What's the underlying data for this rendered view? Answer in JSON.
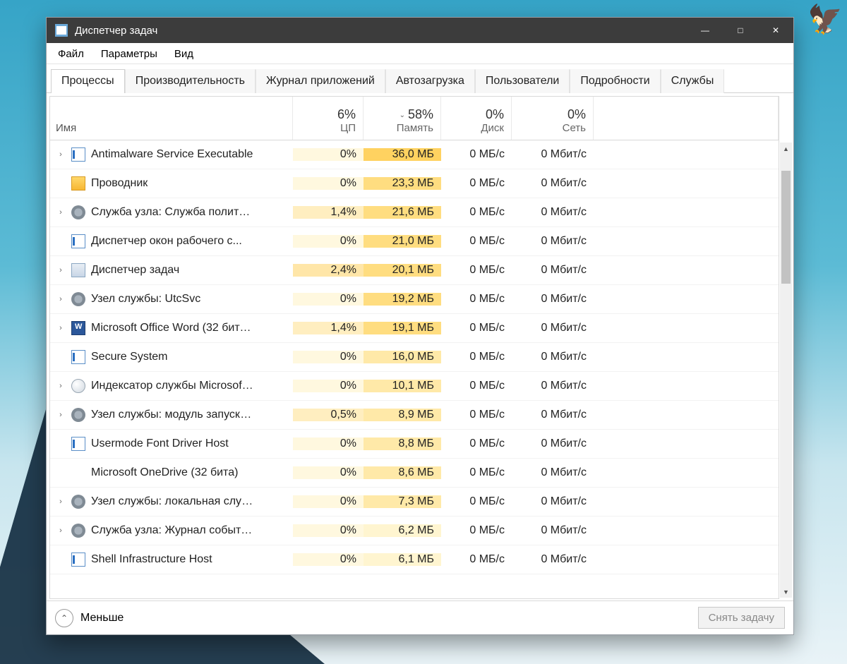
{
  "window": {
    "title": "Диспетчер задач"
  },
  "menu": {
    "file": "Файл",
    "options": "Параметры",
    "view": "Вид"
  },
  "tabs": {
    "processes": "Процессы",
    "performance": "Производительность",
    "apphistory": "Журнал приложений",
    "startup": "Автозагрузка",
    "users": "Пользователи",
    "details": "Подробности",
    "services": "Службы"
  },
  "columns": {
    "name": "Имя",
    "cpu_pct": "6%",
    "cpu_label": "ЦП",
    "mem_pct": "58%",
    "mem_label": "Память",
    "disk_pct": "0%",
    "disk_label": "Диск",
    "net_pct": "0%",
    "net_label": "Сеть"
  },
  "processes": [
    {
      "expand": true,
      "icon": "app",
      "name": "Antimalware Service Executable",
      "cpu": "0%",
      "mem": "36,0 МБ",
      "disk": "0 МБ/с",
      "net": "0 Мбит/с",
      "cpuhl": 0,
      "memhl": 3
    },
    {
      "expand": false,
      "icon": "explorer",
      "name": "Проводник",
      "cpu": "0%",
      "mem": "23,3 МБ",
      "disk": "0 МБ/с",
      "net": "0 Мбит/с",
      "cpuhl": 0,
      "memhl": 2
    },
    {
      "expand": true,
      "icon": "gear",
      "name": "Служба узла: Служба политик...",
      "cpu": "1,4%",
      "mem": "21,6 МБ",
      "disk": "0 МБ/с",
      "net": "0 Мбит/с",
      "cpuhl": 1,
      "memhl": 2
    },
    {
      "expand": false,
      "icon": "app",
      "name": "Диспетчер окон рабочего с...",
      "cpu": "0%",
      "mem": "21,0 МБ",
      "disk": "0 МБ/с",
      "net": "0 Мбит/с",
      "cpuhl": 0,
      "memhl": 2
    },
    {
      "expand": true,
      "icon": "tm",
      "name": "Диспетчер задач",
      "cpu": "2,4%",
      "mem": "20,1 МБ",
      "disk": "0 МБ/с",
      "net": "0 Мбит/с",
      "cpuhl": 2,
      "memhl": 2
    },
    {
      "expand": true,
      "icon": "gear",
      "name": "Узел службы: UtcSvc",
      "cpu": "0%",
      "mem": "19,2 МБ",
      "disk": "0 МБ/с",
      "net": "0 Мбит/с",
      "cpuhl": 0,
      "memhl": 2
    },
    {
      "expand": true,
      "icon": "word",
      "name": "Microsoft Office Word (32 бита...",
      "cpu": "1,4%",
      "mem": "19,1 МБ",
      "disk": "0 МБ/с",
      "net": "0 Мбит/с",
      "cpuhl": 1,
      "memhl": 2
    },
    {
      "expand": false,
      "icon": "app",
      "name": "Secure System",
      "cpu": "0%",
      "mem": "16,0 МБ",
      "disk": "0 МБ/с",
      "net": "0 Мбит/с",
      "cpuhl": 0,
      "memhl": 1
    },
    {
      "expand": true,
      "icon": "search",
      "name": "Индексатор службы Microsoft...",
      "cpu": "0%",
      "mem": "10,1 МБ",
      "disk": "0 МБ/с",
      "net": "0 Мбит/с",
      "cpuhl": 0,
      "memhl": 1
    },
    {
      "expand": true,
      "icon": "gear",
      "name": "Узел службы: модуль запуска ...",
      "cpu": "0,5%",
      "mem": "8,9 МБ",
      "disk": "0 МБ/с",
      "net": "0 Мбит/с",
      "cpuhl": 1,
      "memhl": 1
    },
    {
      "expand": false,
      "icon": "app",
      "name": "Usermode Font Driver Host",
      "cpu": "0%",
      "mem": "8,8 МБ",
      "disk": "0 МБ/с",
      "net": "0 Мбит/с",
      "cpuhl": 0,
      "memhl": 1
    },
    {
      "expand": false,
      "icon": "none",
      "name": "Microsoft OneDrive (32 бита)",
      "cpu": "0%",
      "mem": "8,6 МБ",
      "disk": "0 МБ/с",
      "net": "0 Мбит/с",
      "cpuhl": 0,
      "memhl": 1
    },
    {
      "expand": true,
      "icon": "gear",
      "name": "Узел службы: локальная служ...",
      "cpu": "0%",
      "mem": "7,3 МБ",
      "disk": "0 МБ/с",
      "net": "0 Мбит/с",
      "cpuhl": 0,
      "memhl": 1
    },
    {
      "expand": true,
      "icon": "gear",
      "name": "Служба узла: Журнал событи...",
      "cpu": "0%",
      "mem": "6,2 МБ",
      "disk": "0 МБ/с",
      "net": "0 Мбит/с",
      "cpuhl": 0,
      "memhl": 0
    },
    {
      "expand": false,
      "icon": "app",
      "name": "Shell Infrastructure Host",
      "cpu": "0%",
      "mem": "6,1 МБ",
      "disk": "0 МБ/с",
      "net": "0 Мбит/с",
      "cpuhl": 0,
      "memhl": 0
    }
  ],
  "footer": {
    "fewer": "Меньше",
    "endtask": "Снять задачу"
  }
}
